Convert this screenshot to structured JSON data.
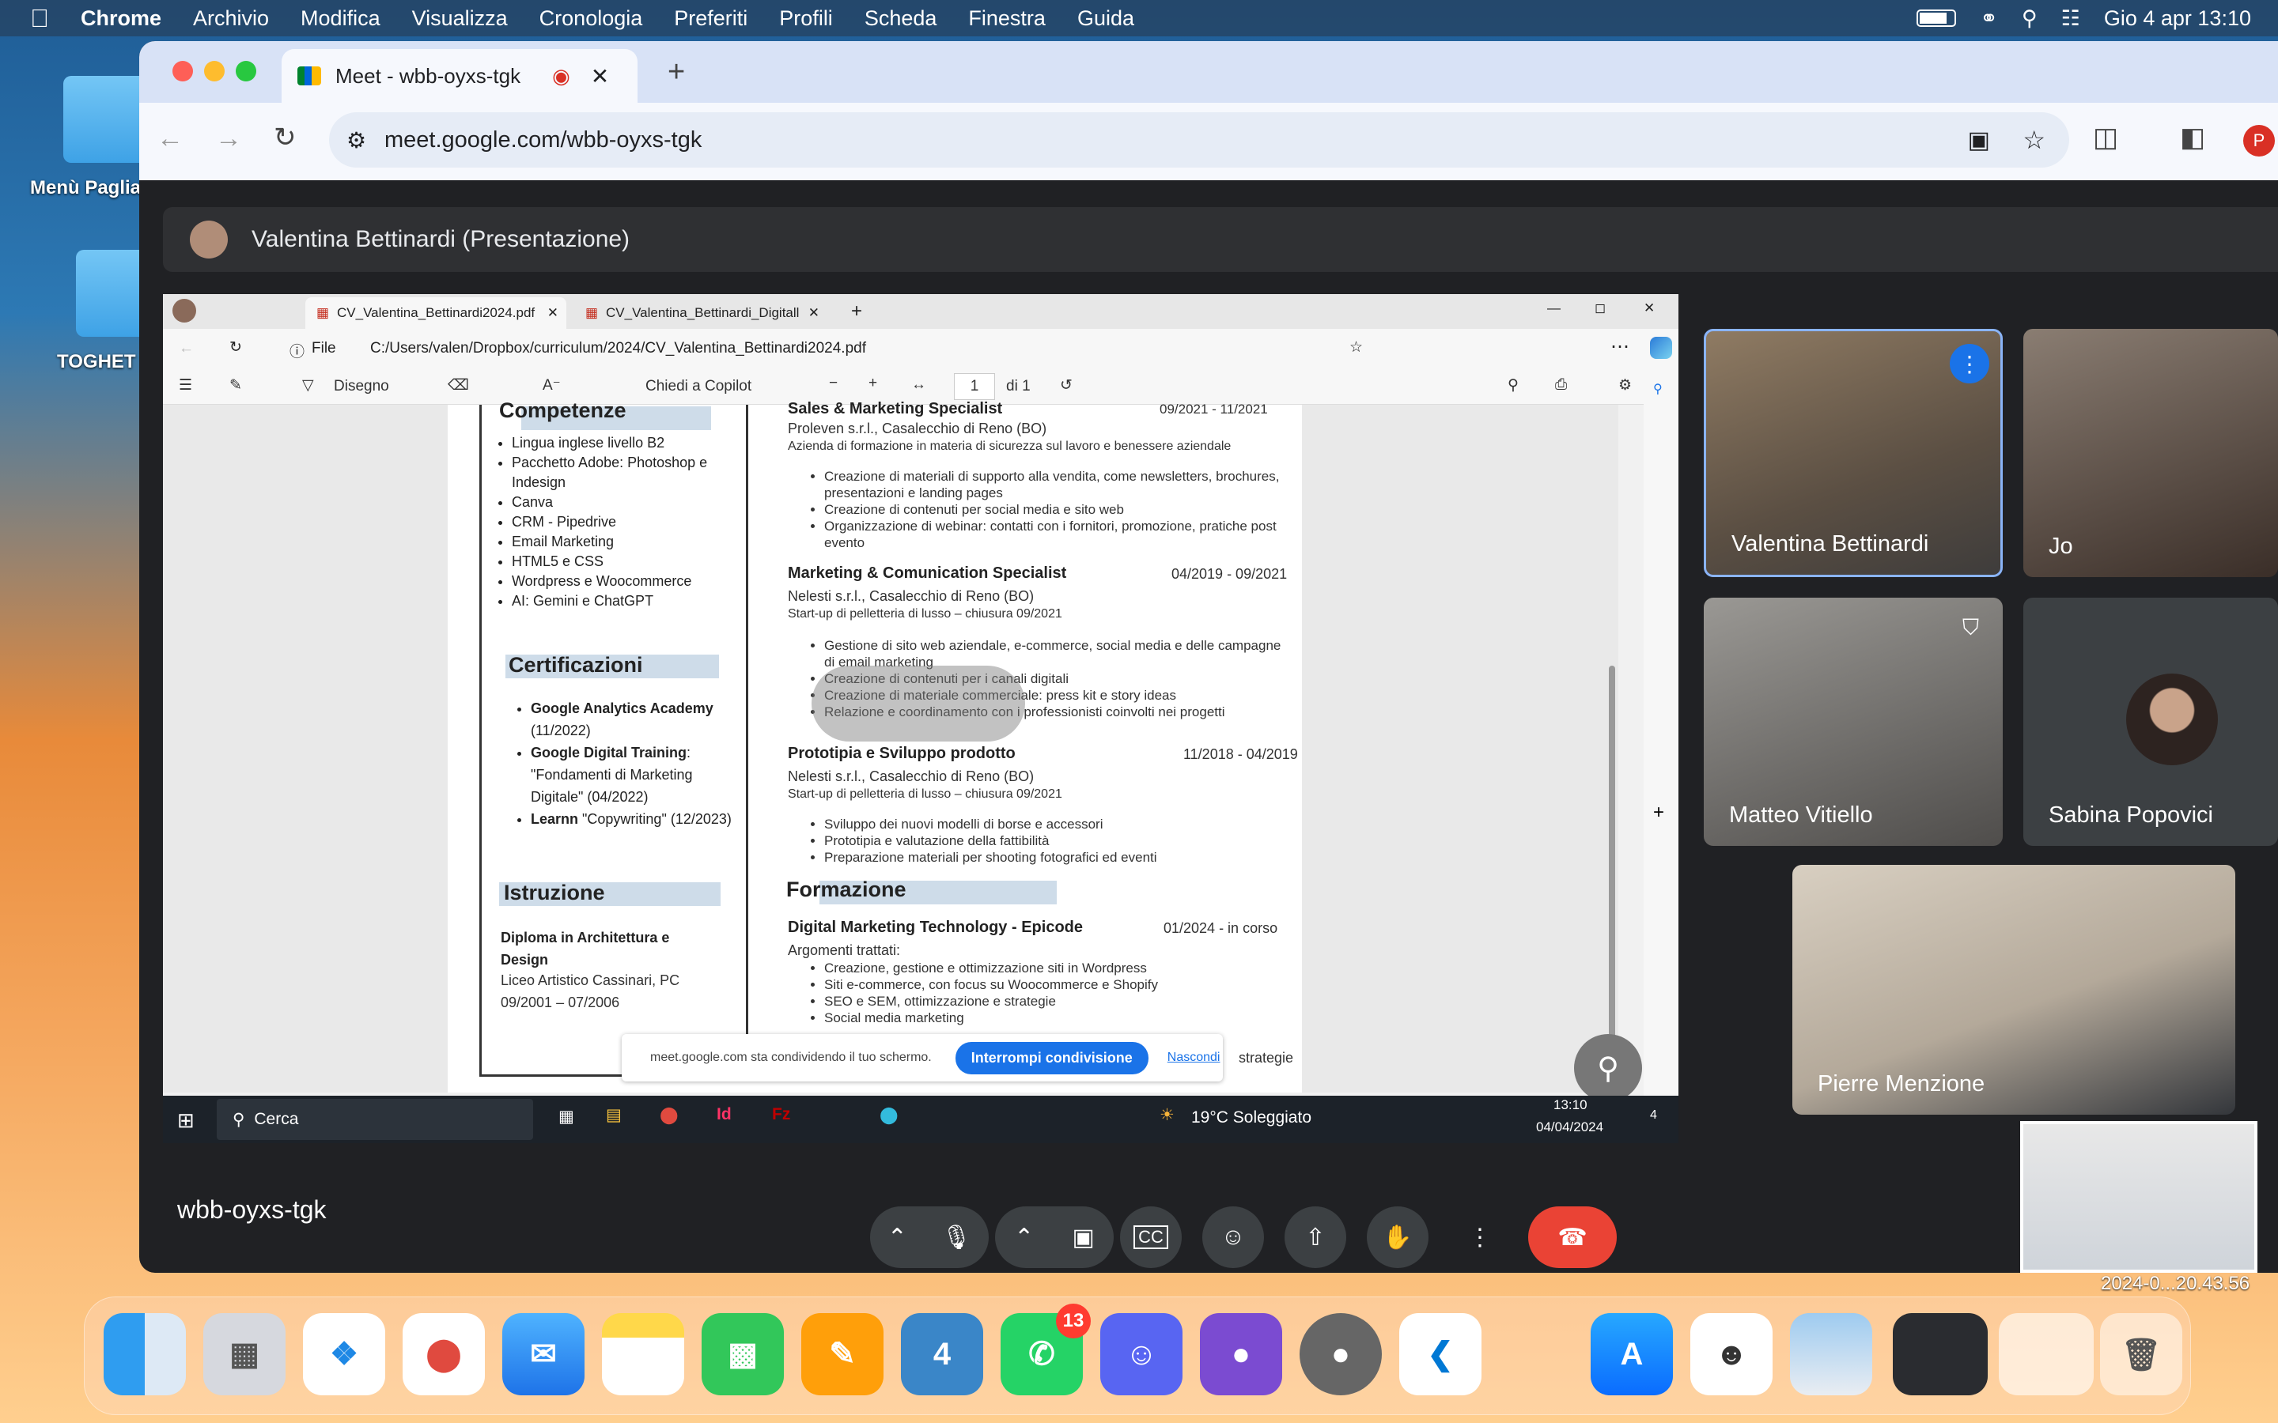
{
  "menubar": {
    "app": "Chrome",
    "items": [
      "Archivio",
      "Modifica",
      "Visualizza",
      "Cronologia",
      "Preferiti",
      "Profili",
      "Scheda",
      "Finestra",
      "Guida"
    ],
    "clock": "Gio 4 apr  13:10"
  },
  "desktop": {
    "icon1": "Menù Paglia",
    "icon2": "TOGHET"
  },
  "browser": {
    "tab_title": "Meet - wbb-oyxs-tgk",
    "url": "meet.google.com/wbb-oyxs-tgk",
    "profile": "P"
  },
  "meet": {
    "presenter": "Valentina Bettinardi (Presentazione)",
    "meeting_code": "wbb-oyxs-tgk",
    "participants": [
      {
        "name": "Valentina Bettinardi"
      },
      {
        "name": "Jo"
      },
      {
        "name": "Matteo Vitiello"
      },
      {
        "name": "Sabina Popovici"
      },
      {
        "name": "Pierre Menzione"
      }
    ],
    "timestamp": "2024-0...20.43.56"
  },
  "edge": {
    "tab1": "CV_Valentina_Bettinardi2024.pdf",
    "tab2": "CV_Valentina_Bettinardi_Digitall",
    "file_label": "File",
    "path": "C:/Users/valen/Dropbox/curriculum/2024/CV_Valentina_Bettinardi2024.pdf",
    "draw": "Disegno",
    "copilot": "Chiedi a Copilot",
    "page": "1",
    "of": "di 1"
  },
  "cv": {
    "competenze_title": "Competenze",
    "skills": [
      "Lingua inglese livello B2",
      "Pacchetto Adobe: Photoshop e Indesign",
      "Canva",
      "CRM - Pipedrive",
      "Email Marketing",
      "HTML5 e CSS",
      "Wordpress e Woocommerce",
      "AI: Gemini e ChatGPT"
    ],
    "cert_title": "Certificazioni",
    "certs": [
      {
        "b": "Google Analytics Academy",
        "t": " (11/2022)"
      },
      {
        "b": "Google Digital Training",
        "t": ": \"Fondamenti di Marketing Digitale\" (04/2022)"
      },
      {
        "b": "Learnn",
        "t": " \"Copywriting\" (12/2023)"
      }
    ],
    "istr_title": "Istruzione",
    "istr_degree": "Diploma in Architettura e Design",
    "istr_school": "Liceo Artistico Cassinari, PC",
    "istr_dates": "09/2001 – 07/2006",
    "job0_title": "Sales & Marketing Specialist",
    "job0_dates": "09/2021 - 11/2021",
    "job0_company": "Proleven s.r.l., Casalecchio di Reno (BO)",
    "job0_desc": "Azienda di formazione in materia di sicurezza sul lavoro e benessere aziendale",
    "job0_bullets": [
      "Creazione di materiali di supporto alla vendita, come newsletters, brochures, presentazioni e landing pages",
      "Creazione di contenuti per social media e sito web",
      "Organizzazione di webinar: contatti con i fornitori, promozione, pratiche post evento"
    ],
    "job1_title": "Marketing & Comunication Specialist",
    "job1_dates": "04/2019 - 09/2021",
    "job1_company": "Nelesti s.r.l., Casalecchio di Reno (BO)",
    "job1_desc": "Start-up di pelletteria di lusso – chiusura 09/2021",
    "job1_bullets": [
      "Gestione di sito web aziendale, e-commerce, social media e delle campagne di email marketing",
      "Creazione di contenuti per i canali digitali",
      "Creazione di materiale commerciale: press kit e story ideas",
      "Relazione e coordinamento con i professionisti coinvolti nei progetti"
    ],
    "job2_title": "Prototipia e Sviluppo prodotto",
    "job2_dates": "11/2018 - 04/2019",
    "job2_company": "Nelesti s.r.l., Casalecchio di Reno (BO)",
    "job2_desc": "Start-up di pelletteria di lusso – chiusura 09/2021",
    "job2_bullets": [
      "Sviluppo dei nuovi modelli di borse e accessori",
      "Prototipia e valutazione della fattibilità",
      "Preparazione materiali per shooting fotografici ed eventi"
    ],
    "form_title": "Formazione",
    "course_title": "Digital Marketing Technology - Epicode",
    "course_dates": "01/2024 - in corso",
    "course_sub": "Argomenti trattati:",
    "course_bullets": [
      "Creazione, gestione e ottimizzazione siti in Wordpress",
      "Siti e-commerce, con focus su Woocommerce e Shopify",
      "SEO e SEM, ottimizzazione e strategie",
      "Social media marketing"
    ],
    "tail": "strategie"
  },
  "sharebar": {
    "text": "meet.google.com sta condividendo il tuo schermo.",
    "stop": "Interrompi condivisione",
    "hide": "Nascondi"
  },
  "taskbar": {
    "search": "Cerca",
    "weather": "19°C  Soleggiato",
    "time": "13:10",
    "date": "04/04/2024",
    "notif": "4"
  },
  "dock": {
    "whatsapp_badge": "13"
  }
}
